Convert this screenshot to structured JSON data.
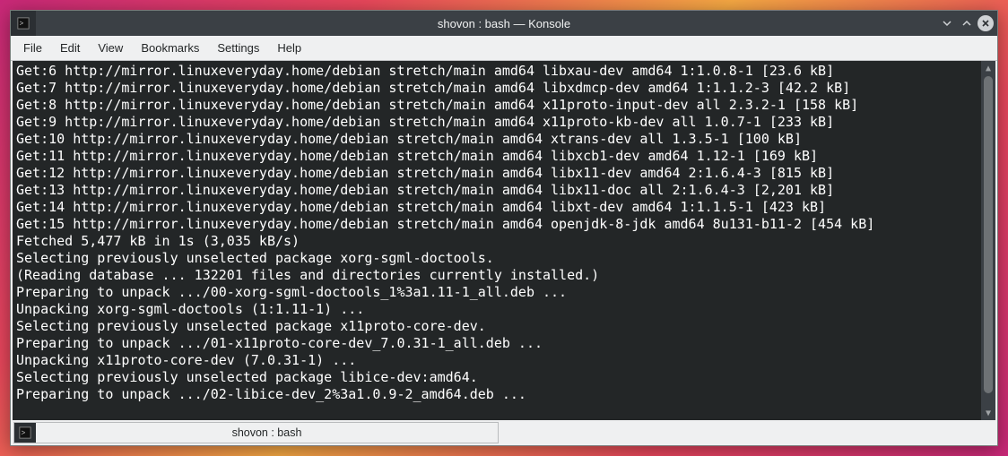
{
  "window": {
    "title": "shovon : bash — Konsole"
  },
  "menubar": {
    "items": [
      "File",
      "Edit",
      "View",
      "Bookmarks",
      "Settings",
      "Help"
    ]
  },
  "terminal": {
    "lines": [
      "Get:6 http://mirror.linuxeveryday.home/debian stretch/main amd64 libxau-dev amd64 1:1.0.8-1 [23.6 kB]",
      "Get:7 http://mirror.linuxeveryday.home/debian stretch/main amd64 libxdmcp-dev amd64 1:1.1.2-3 [42.2 kB]",
      "Get:8 http://mirror.linuxeveryday.home/debian stretch/main amd64 x11proto-input-dev all 2.3.2-1 [158 kB]",
      "Get:9 http://mirror.linuxeveryday.home/debian stretch/main amd64 x11proto-kb-dev all 1.0.7-1 [233 kB]",
      "Get:10 http://mirror.linuxeveryday.home/debian stretch/main amd64 xtrans-dev all 1.3.5-1 [100 kB]",
      "Get:11 http://mirror.linuxeveryday.home/debian stretch/main amd64 libxcb1-dev amd64 1.12-1 [169 kB]",
      "Get:12 http://mirror.linuxeveryday.home/debian stretch/main amd64 libx11-dev amd64 2:1.6.4-3 [815 kB]",
      "Get:13 http://mirror.linuxeveryday.home/debian stretch/main amd64 libx11-doc all 2:1.6.4-3 [2,201 kB]",
      "Get:14 http://mirror.linuxeveryday.home/debian stretch/main amd64 libxt-dev amd64 1:1.1.5-1 [423 kB]",
      "Get:15 http://mirror.linuxeveryday.home/debian stretch/main amd64 openjdk-8-jdk amd64 8u131-b11-2 [454 kB]",
      "Fetched 5,477 kB in 1s (3,035 kB/s)",
      "Selecting previously unselected package xorg-sgml-doctools.",
      "(Reading database ... 132201 files and directories currently installed.)",
      "Preparing to unpack .../00-xorg-sgml-doctools_1%3a1.11-1_all.deb ...",
      "Unpacking xorg-sgml-doctools (1:1.11-1) ...",
      "Selecting previously unselected package x11proto-core-dev.",
      "Preparing to unpack .../01-x11proto-core-dev_7.0.31-1_all.deb ...",
      "Unpacking x11proto-core-dev (7.0.31-1) ...",
      "Selecting previously unselected package libice-dev:amd64.",
      "Preparing to unpack .../02-libice-dev_2%3a1.0.9-2_amd64.deb ..."
    ]
  },
  "statusbar": {
    "tab_label": "shovon : bash"
  }
}
